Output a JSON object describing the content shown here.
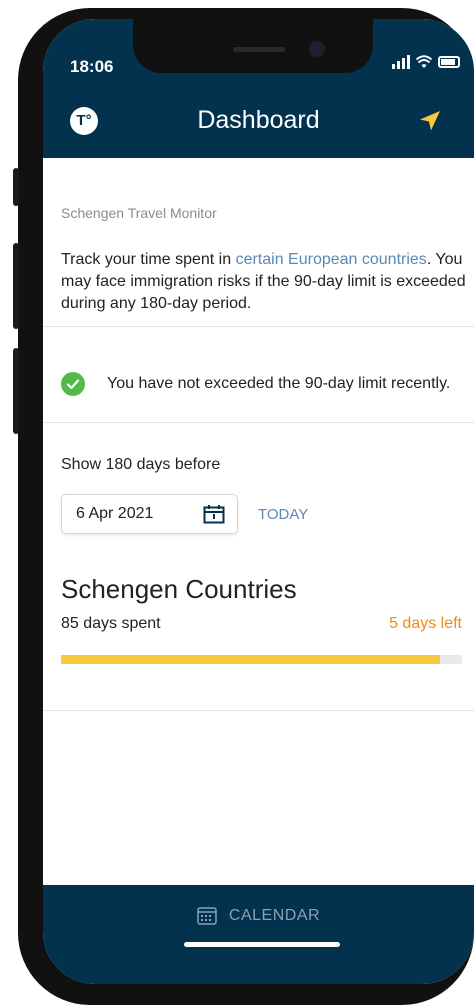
{
  "status_bar": {
    "time": "18:06"
  },
  "header": {
    "title": "Dashboard",
    "logo_text": "T°"
  },
  "monitor": {
    "label": "Schengen Travel Monitor",
    "desc_before": "Track your time spent in ",
    "desc_link": "certain European countries",
    "desc_after": ". You may face immigration risks if the 90-day limit is exceeded during any 180-day period."
  },
  "status": {
    "message": "You have not exceeded the 90-day limit recently."
  },
  "date_picker": {
    "label": "Show 180 days before",
    "value": "6 Apr 2021",
    "today_label": "TODAY"
  },
  "region": {
    "title": "Schengen Countries",
    "days_spent": "85 days spent",
    "days_left": "5 days left",
    "progress_fraction": 0.944
  },
  "bottom_nav": {
    "calendar_label": "CALENDAR"
  },
  "colors": {
    "header_bg": "#03324e",
    "link": "#5c88b6",
    "accent_orange": "#f08a17",
    "progress": "#f7ca3e",
    "success": "#54b948"
  }
}
